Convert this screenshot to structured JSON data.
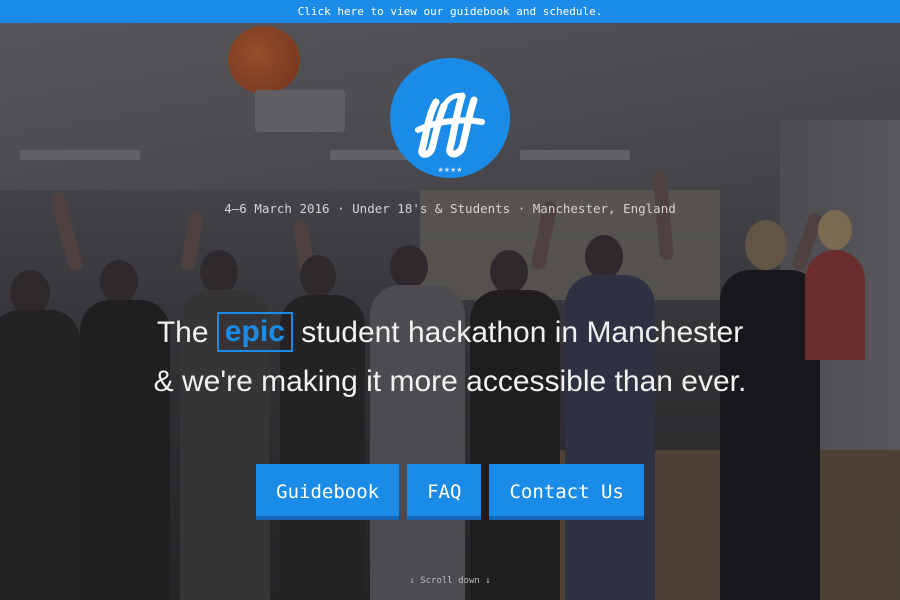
{
  "banner": {
    "link_prefix": "Click",
    "link_text": "here",
    "suffix": "to view our guidebook and schedule."
  },
  "logo": {
    "letter": "H",
    "stars": "★★★★",
    "icon": "hackathon-h-logo",
    "color": "#1a8be6"
  },
  "event_details": "4–6 March 2016 · Under 18's & Students · Manchester, England",
  "headline": {
    "prefix": "The",
    "highlight": "epic",
    "line1_rest": "student hackathon in Manchester",
    "line2": "& we're making it more accessible than ever."
  },
  "buttons": [
    {
      "label": "Guidebook"
    },
    {
      "label": "FAQ"
    },
    {
      "label": "Contact Us"
    }
  ],
  "scroll_hint": "↓ Scroll down ↓",
  "colors": {
    "accent": "#1a8be6",
    "accent_dark": "#1467b8",
    "text": "#f1f1f1"
  }
}
